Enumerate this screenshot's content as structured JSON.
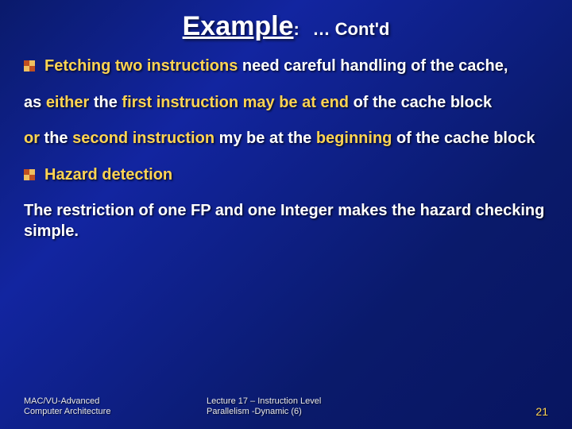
{
  "title": {
    "main": "Example",
    "colon": ":",
    "cont": "… Cont'd"
  },
  "bullets": [
    {
      "hasMarker": true,
      "segments": [
        {
          "text": "Fetching two instructions",
          "y": true
        },
        {
          "text": " need careful handling of the cache,",
          "y": false
        }
      ]
    },
    {
      "hasMarker": false,
      "segments": [
        {
          "text": "as ",
          "y": false
        },
        {
          "text": "either",
          "y": true
        },
        {
          "text": " the ",
          "y": false
        },
        {
          "text": "first instruction may be at end",
          "y": true
        },
        {
          "text": " of the cache block",
          "y": false
        }
      ]
    },
    {
      "hasMarker": false,
      "segments": [
        {
          "text": "or",
          "y": true
        },
        {
          "text": " the ",
          "y": false
        },
        {
          "text": "second instruction",
          "y": true
        },
        {
          "text": " my be at the ",
          "y": false
        },
        {
          "text": "beginning",
          "y": true
        },
        {
          "text": " of the cache block",
          "y": false
        }
      ]
    },
    {
      "hasMarker": true,
      "segments": [
        {
          "text": "Hazard detection",
          "y": true
        }
      ]
    },
    {
      "hasMarker": false,
      "segments": [
        {
          "text": "The restriction of one FP and one Integer makes the hazard checking simple.",
          "y": false
        }
      ]
    }
  ],
  "footer": {
    "left1": "MAC/VU-Advanced",
    "left2": "Computer Architecture",
    "center1": "Lecture 17 – Instruction Level",
    "center2": "Parallelism -Dynamic (6)",
    "page": "21"
  }
}
